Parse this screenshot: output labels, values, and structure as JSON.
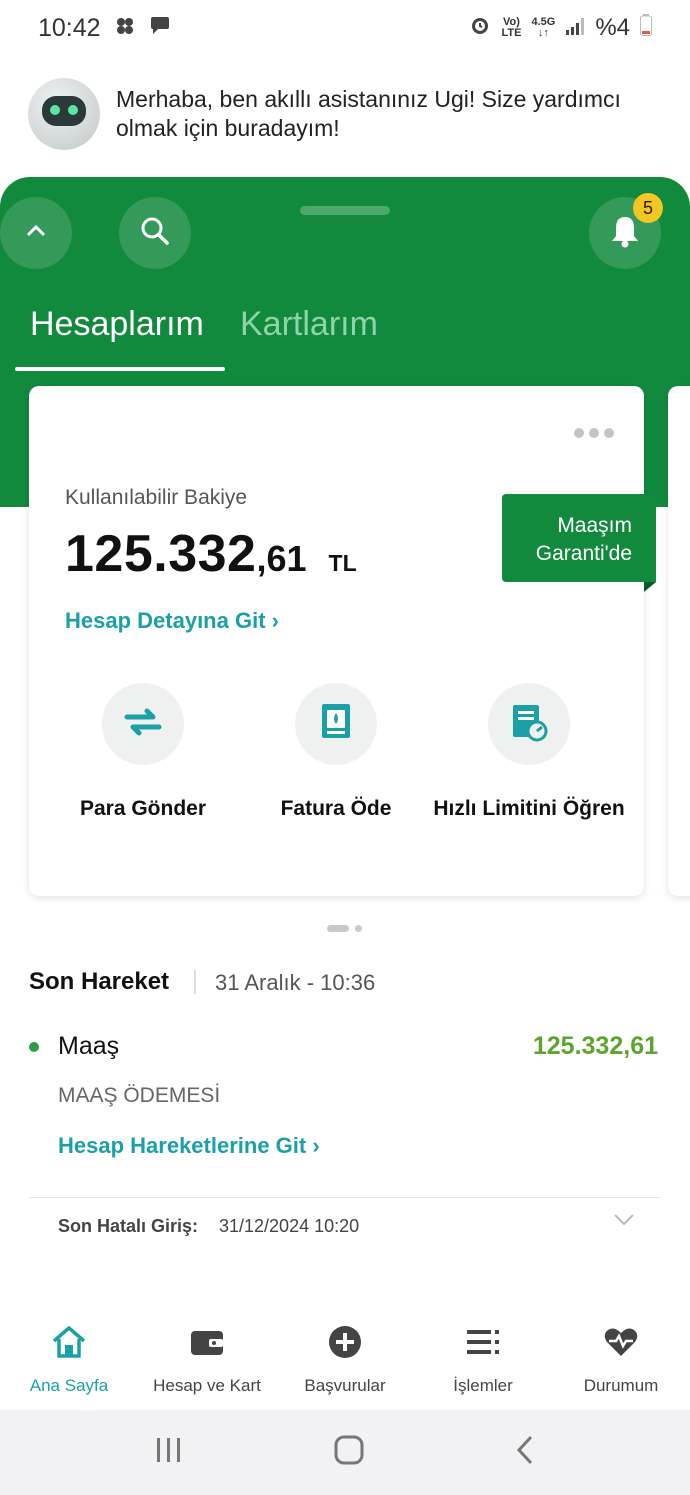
{
  "status_bar": {
    "time": "10:42",
    "network_top": "Vo)",
    "network_bottom": "LTE",
    "data_type": "4.5G",
    "battery": "%4"
  },
  "assistant": {
    "message": "Merhaba, ben akıllı asistanınız Ugi! Size yardımcı olmak için buradayım!"
  },
  "header": {
    "notification_count": "5",
    "tabs": [
      {
        "label": "Hesaplarım",
        "active": true
      },
      {
        "label": "Kartlarım",
        "active": false
      }
    ]
  },
  "account_card": {
    "balance_label": "Kullanılabilir Bakiye",
    "balance_integer": "125.332",
    "balance_decimal": ",61",
    "currency": "TL",
    "detail_link": "Hesap Detayına Git",
    "salary_tag": "Maaşım Garanti'de",
    "actions": [
      {
        "label": "Para Gönder",
        "icon": "transfer-arrows-icon"
      },
      {
        "label": "Fatura Öde",
        "icon": "bill-icon"
      },
      {
        "label": "Hızlı Limitini Öğren",
        "icon": "limit-gauge-icon"
      }
    ]
  },
  "last_transaction": {
    "title": "Son Hareket",
    "date": "31 Aralık - 10:36",
    "name": "Maaş",
    "amount": "125.332,61",
    "description": "MAAŞ ÖDEMESİ",
    "link": "Hesap Hareketlerine Git"
  },
  "failed_login": {
    "label": "Son Hatalı Giriş:",
    "value": "31/12/2024 10:20"
  },
  "bottom_nav": [
    {
      "label": "Ana Sayfa",
      "icon": "home-icon",
      "active": true
    },
    {
      "label": "Hesap ve Kart",
      "icon": "wallet-icon",
      "active": false
    },
    {
      "label": "Başvurular",
      "icon": "plus-circle-icon",
      "active": false
    },
    {
      "label": "İşlemler",
      "icon": "list-icon",
      "active": false
    },
    {
      "label": "Durumum",
      "icon": "heart-pulse-icon",
      "active": false
    }
  ],
  "colors": {
    "brand_green": "#128a3e",
    "link_teal": "#1ba0a8",
    "amount_green": "#5ba52e",
    "badge_yellow": "#f3c623"
  }
}
